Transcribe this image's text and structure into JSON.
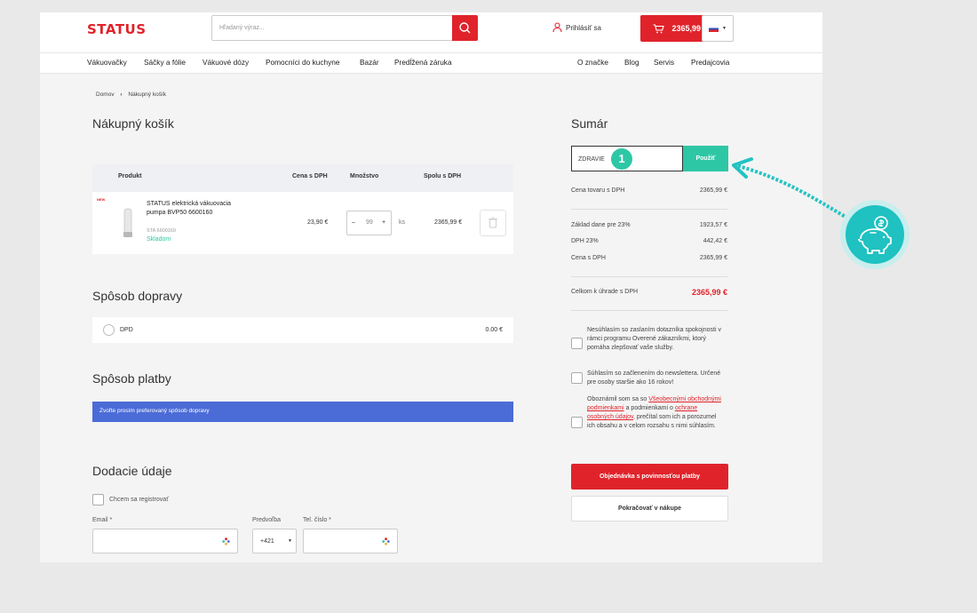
{
  "header": {
    "logo": "STATUS",
    "search_placeholder": "Hľadaný výraz...",
    "login": "Prihlásiť sa",
    "cart_total": "2365,99 €"
  },
  "nav": {
    "left": [
      "Vákuovačky",
      "Sáčky a fólie",
      "Vákuové dózy",
      "Pomocníci do kuchyne",
      "Bazár",
      "Predĺžená záruka"
    ],
    "right": [
      "O značke",
      "Blog",
      "Servis",
      "Predajcovia"
    ]
  },
  "breadcrumb": [
    "Domov",
    "Nákupný košík"
  ],
  "cart": {
    "title": "Nákupný košík",
    "headers": [
      "Produkt",
      "Cena s DPH",
      "Množstvo",
      "Spolu s DPH"
    ],
    "item": {
      "badge": "NEW",
      "name": "STATUS elektrická vákuovacia pumpa BVP50 6600160",
      "sku": "STA 6600160",
      "stock": "Skladom",
      "price": "23,90 €",
      "qty": "99",
      "unit": "ks",
      "total": "2365,99 €",
      "qty_minus": "–",
      "qty_plus": "+"
    }
  },
  "shipping": {
    "title": "Spôsob dopravy",
    "option": "DPD",
    "price": "0.00 €"
  },
  "payment": {
    "title": "Spôsob platby",
    "notice": "Zvoľte prosím preferovaný spôsob dopravy"
  },
  "delivery": {
    "title": "Dodacie údaje",
    "register_label": "Chcem sa registrovať",
    "email_label": "Email *",
    "prefix_label": "Predvoľba",
    "prefix_value": "+421",
    "phone_label": "Tel. číslo *"
  },
  "summary": {
    "title": "Sumár",
    "coupon_value": "ZDRAVIE",
    "coupon_button": "Použiť",
    "step": "1",
    "goods_label": "Cena tovaru s DPH",
    "goods_value": "2365,99 €",
    "base_label": "Základ dane pre 23%",
    "base_value": "1923,57 €",
    "vat_label": "DPH 23%",
    "vat_value": "442,42 €",
    "price_label": "Cena s DPH",
    "price_value": "2365,99 €",
    "total_label": "Celkom k úhrade s DPH",
    "total_value": "2365,99 €",
    "consent1": "Nesúhlasím so zaslaním dotazníka spokojnosti v rámci programu Overené zákazníkmi, ktorý pomáha zlepšovať vaše služby.",
    "consent2": "Súhlasím so začlenením do newslettera. Určené pre osoby staršie ako 16 rokov!",
    "consent3_a": "Oboznámil som sa so ",
    "consent3_link1": "Všeobecnými obchodnými podmienkami",
    "consent3_b": " a podmienkami o ",
    "consent3_link2": "ochrane osobných údajov",
    "consent3_c": ", prečítal som ich a porozumel ich obsahu a v celom rozsahu s nimi súhlasím.",
    "order_button": "Objednávka s povinnosťou platby",
    "continue_button": "Pokračovať v nákupe"
  },
  "colors": {
    "brand": "#e0232b",
    "accent": "#2ec7a5",
    "notice": "#4b6bd7",
    "annotation": "#22c3c3"
  }
}
